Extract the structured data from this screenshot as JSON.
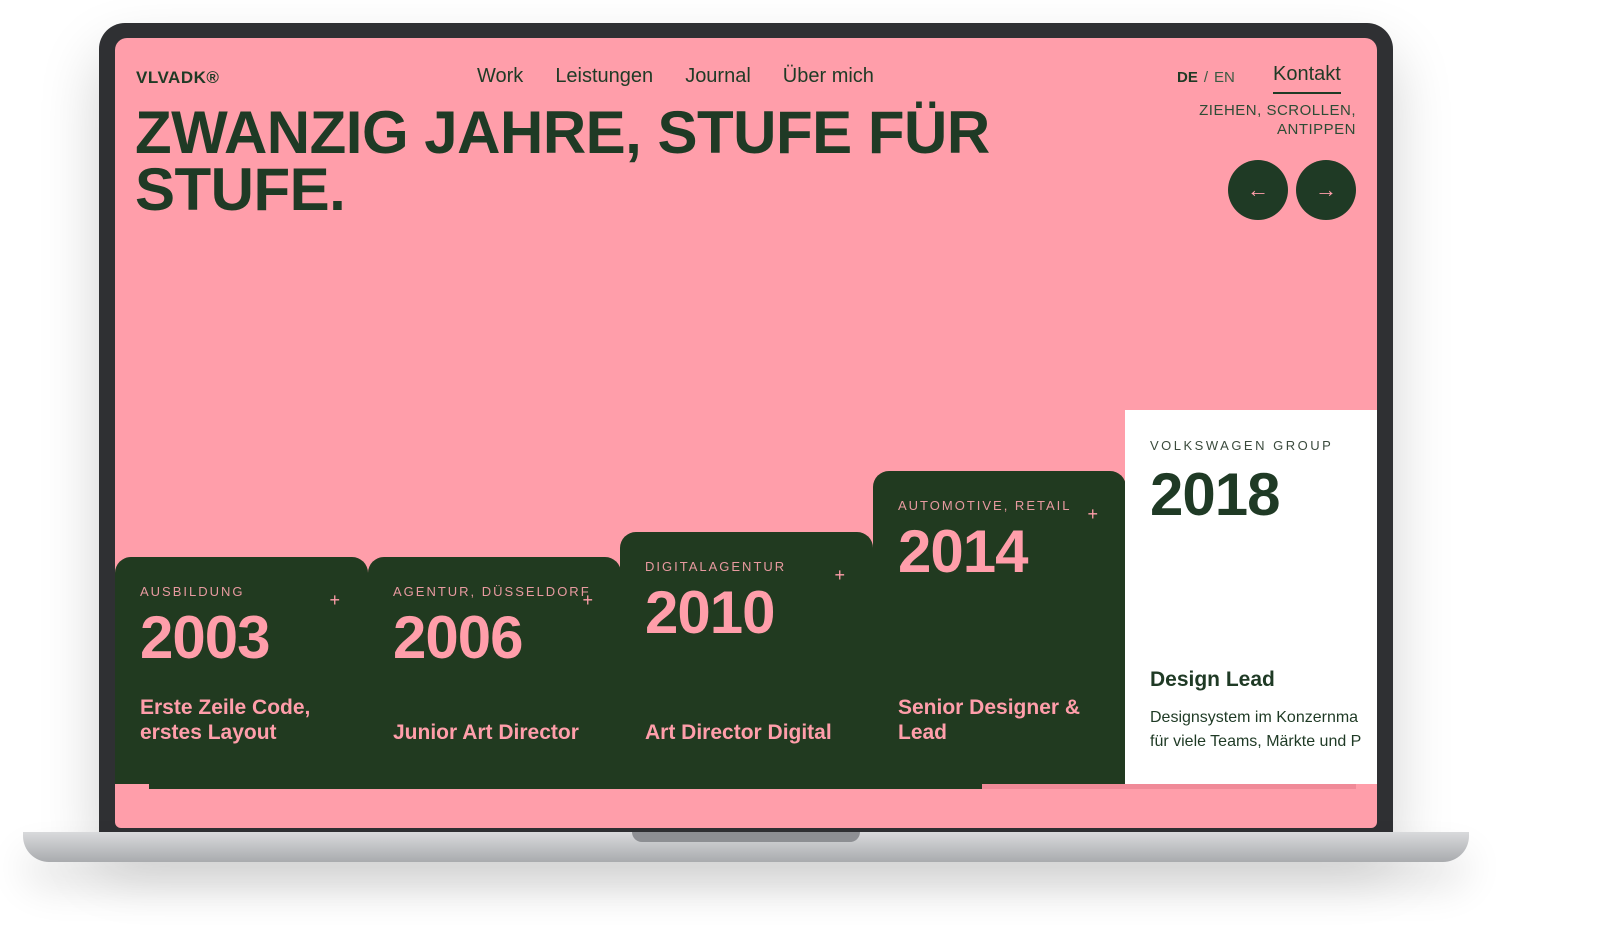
{
  "logo": "VLVADK®",
  "nav": {
    "items": [
      "Work",
      "Leistungen",
      "Journal",
      "Über mich"
    ],
    "lang_active": "DE",
    "lang_separator": "/",
    "lang_other": "EN",
    "contact": "Kontakt"
  },
  "hero": {
    "headline_line1": "ZWANZIG JAHRE, STUFE FÜR",
    "headline_line2": "STUFE.",
    "hint": "ZIEHEN, SCROLLEN, ANTIPPEN",
    "prev_icon": "arrow-left-icon",
    "prev_glyph": "←",
    "next_icon": "arrow-right-icon",
    "next_glyph": "→"
  },
  "cards": [
    {
      "tag": "AUSBILDUNG",
      "year": "2003",
      "role": "Erste Zeile Code, erstes Layout",
      "plus": "+"
    },
    {
      "tag": "AGENTUR, DÜSSELDORF",
      "year": "2006",
      "role": "Junior Art Director",
      "plus": "+"
    },
    {
      "tag": "DIGITALAGENTUR",
      "year": "2010",
      "role": "Art Director Digital",
      "plus": "+"
    },
    {
      "tag": "AUTOMOTIVE, RETAIL",
      "year": "2014",
      "role": "Senior Designer & Lead",
      "plus": "+"
    }
  ],
  "active_card": {
    "tag": "VOLKSWAGEN GROUP",
    "year": "2018",
    "role": "Design Lead",
    "desc_line1": "Designsystem im Konzernma",
    "desc_line2": "für viele Teams, Märkte und P"
  },
  "progress": {
    "fraction": 0.69
  },
  "colors": {
    "background": "#ff9eaa",
    "dark_green": "#213a20",
    "text": "#1f3a25"
  }
}
